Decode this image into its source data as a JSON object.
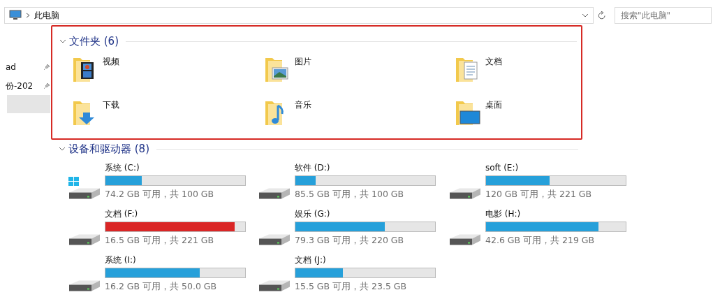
{
  "address_bar": {
    "path": "此电脑",
    "search_placeholder": "搜索\"此电脑\""
  },
  "sidebar": {
    "items": [
      {
        "label": "ad",
        "pinned": true,
        "selected": false
      },
      {
        "label": "份-202",
        "pinned": true,
        "selected": false
      },
      {
        "selected": true
      }
    ]
  },
  "folders": {
    "title": "文件夹 (6)",
    "highlighted": true,
    "items": [
      {
        "name": "视频",
        "kind": "video"
      },
      {
        "name": "图片",
        "kind": "pictures"
      },
      {
        "name": "文档",
        "kind": "documents"
      },
      {
        "name": "下载",
        "kind": "downloads"
      },
      {
        "name": "音乐",
        "kind": "music"
      },
      {
        "name": "桌面",
        "kind": "desktop"
      }
    ]
  },
  "drives": {
    "title": "设备和驱动器 (8)",
    "items": [
      {
        "name": "系统 (C:)",
        "system": true,
        "level": 0.26,
        "color": "#26a0da",
        "space": "74.2 GB 可用，共 100 GB"
      },
      {
        "name": "软件 (D:)",
        "system": false,
        "level": 0.145,
        "color": "#26a0da",
        "space": "85.5 GB 可用，共 100 GB"
      },
      {
        "name": "soft (E:)",
        "system": false,
        "level": 0.457,
        "color": "#26a0da",
        "space": "120 GB 可用，共 221 GB"
      },
      {
        "name": "文档 (F:)",
        "system": false,
        "level": 0.925,
        "color": "#da2626",
        "space": "16.5 GB 可用，共 221 GB"
      },
      {
        "name": "娱乐 (G:)",
        "system": false,
        "level": 0.64,
        "color": "#26a0da",
        "space": "79.3 GB 可用，共 220 GB"
      },
      {
        "name": "电影 (H:)",
        "system": false,
        "level": 0.805,
        "color": "#26a0da",
        "space": "42.6 GB 可用，共 219 GB"
      },
      {
        "name": "系统 (I:)",
        "system": false,
        "level": 0.676,
        "color": "#26a0da",
        "space": "16.2 GB 可用，共 50.0 GB"
      },
      {
        "name": "文档 (J:)",
        "system": false,
        "level": 0.34,
        "color": "#26a0da",
        "space": "15.5 GB 可用，共 23.5 GB"
      }
    ]
  }
}
